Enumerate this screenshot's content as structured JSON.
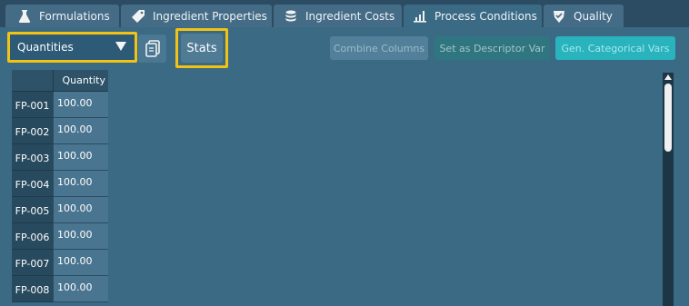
{
  "tabs": [
    {
      "label": "Formulations",
      "icon": "flask-icon"
    },
    {
      "label": "Ingredient Properties",
      "icon": "tag-icon"
    },
    {
      "label": "Ingredient Costs",
      "icon": "coins-icon"
    },
    {
      "label": "Process Conditions",
      "icon": "bar-chart-icon",
      "active": true
    },
    {
      "label": "Quality",
      "icon": "certificate-icon"
    }
  ],
  "toolbar": {
    "dropdown_value": "Quantities",
    "copy_icon": "copy-icon",
    "stats_label": "Stats",
    "combine_label": "Combine Columns",
    "descriptor_label": "Set as Descriptor Var",
    "categorical_label": "Gen. Categorical Vars"
  },
  "table": {
    "column_header": "Quantity",
    "rows": [
      {
        "id": "FP-001",
        "value": "100.00"
      },
      {
        "id": "FP-002",
        "value": "100.00"
      },
      {
        "id": "FP-003",
        "value": "100.00"
      },
      {
        "id": "FP-004",
        "value": "100.00"
      },
      {
        "id": "FP-005",
        "value": "100.00"
      },
      {
        "id": "FP-006",
        "value": "100.00"
      },
      {
        "id": "FP-007",
        "value": "100.00"
      },
      {
        "id": "FP-008",
        "value": "100.00"
      }
    ]
  },
  "colors": {
    "background": "#3b6a85",
    "tab_bar": "#2b4c63",
    "highlight": "#f2c314",
    "teal_button": "#28b3bd"
  }
}
